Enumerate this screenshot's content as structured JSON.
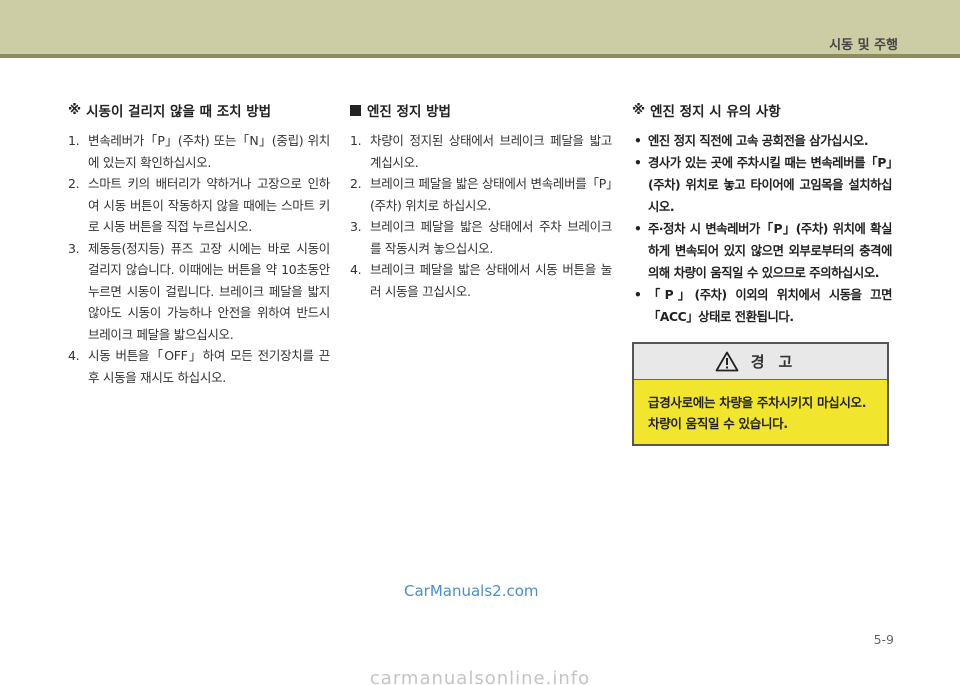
{
  "header": {
    "title": "시동 및 주행"
  },
  "col1": {
    "mark": "※",
    "title": "시동이 걸리지 않을 때 조치 방법",
    "steps": [
      {
        "num": "1.",
        "text": "변속레버가「P」(주차) 또는「N」(중립) 위치에 있는지 확인하십시오."
      },
      {
        "num": "2.",
        "text": "스마트 키의 배터리가 약하거나 고장으로 인하여 시동 버튼이 작동하지 않을 때에는 스마트 키로 시동 버튼을 직접 누르십시오."
      },
      {
        "num": "3.",
        "text": "제동등(정지등) 퓨즈 고장 시에는 바로 시동이 걸리지 않습니다. 이때에는 버튼을 약 10초동안 누르면 시동이 걸립니다. 브레이크 페달을 밟지 않아도 시동이 가능하나 안전을 위하여 반드시 브레이크 페달을 밟으십시오."
      },
      {
        "num": "4.",
        "text": "시동 버튼을「OFF」하여 모든 전기장치를 끈 후 시동을 재시도 하십시오."
      }
    ]
  },
  "col2": {
    "title": "엔진 정지 방법",
    "steps": [
      {
        "num": "1.",
        "text": "차량이 정지된 상태에서 브레이크 페달을 밟고 계십시오."
      },
      {
        "num": "2.",
        "text": "브레이크 페달을 밟은 상태에서 변속레버를「P」(주차) 위치로 하십시오."
      },
      {
        "num": "3.",
        "text": "브레이크 페달을 밟은 상태에서 주차 브레이크를 작동시켜 놓으십시오."
      },
      {
        "num": "4.",
        "text": "브레이크 페달을 밟은 상태에서 시동 버튼을 눌러 시동을 끄십시오."
      }
    ]
  },
  "col3": {
    "mark": "※",
    "title": "엔진 정지 시 유의 사항",
    "bullets": [
      "엔진 정지 직전에 고속 공회전을 삼가십시오.",
      "경사가 있는 곳에 주차시킬 때는 변속레버를「P」(주차) 위치로 놓고 타이어에 고임목을 설치하십시오.",
      "주·정차 시 변속레버가「P」(주차) 위치에 확실하게 변속되어 있지 않으면 외부로부터의 충격에 의해 차량이 움직일 수 있으므로 주의하십시오.",
      "「P」(주차) 이외의 위치에서 시동을 끄면「ACC」상태로 전환됩니다."
    ]
  },
  "warning": {
    "label": "경고",
    "lines": [
      "급경사로에는 차량을 주차시키지 마십시오.",
      "차량이 움직일 수 있습니다."
    ]
  },
  "watermark": "CarManuals2.com",
  "page_number": "5-9",
  "footer": "carmanualsonline.info"
}
